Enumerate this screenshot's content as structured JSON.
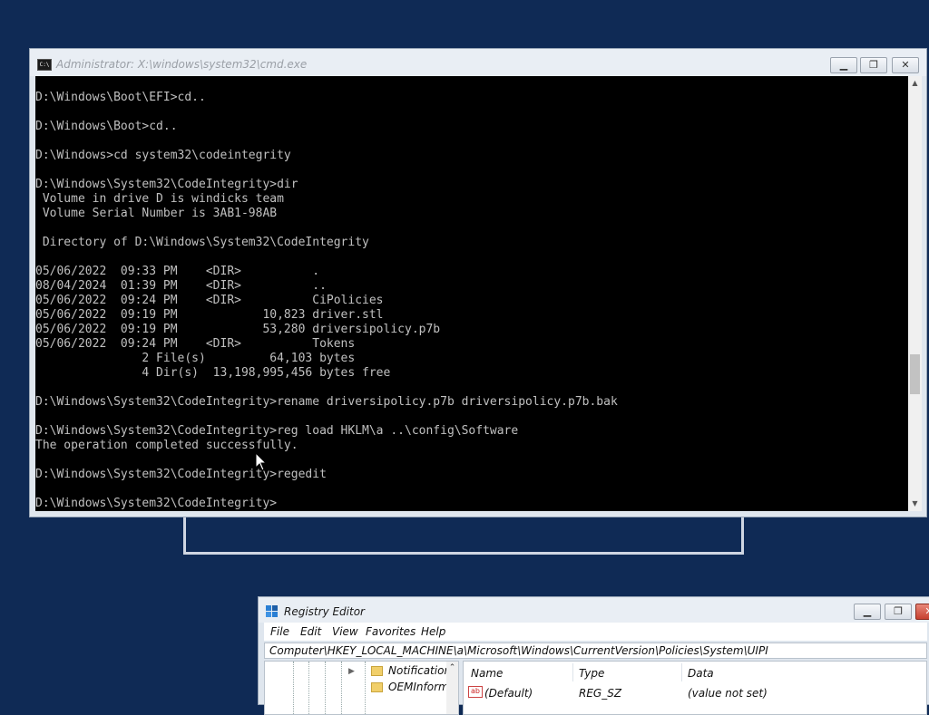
{
  "cmd_window": {
    "title": "Administrator: X:\\windows\\system32\\cmd.exe",
    "icon": "cmd-icon",
    "buttons": {
      "minimize": "minimize-icon",
      "maximize": "maximize-icon",
      "close": "close-icon"
    },
    "lines": [
      "D:\\Windows\\Boot\\EFI>cd..",
      "",
      "D:\\Windows\\Boot>cd..",
      "",
      "D:\\Windows>cd system32\\codeintegrity",
      "",
      "D:\\Windows\\System32\\CodeIntegrity>dir",
      " Volume in drive D is windicks team",
      " Volume Serial Number is 3AB1-98AB",
      "",
      " Directory of D:\\Windows\\System32\\CodeIntegrity",
      "",
      "05/06/2022  09:33 PM    <DIR>          .",
      "08/04/2024  01:39 PM    <DIR>          ..",
      "05/06/2022  09:24 PM    <DIR>          CiPolicies",
      "05/06/2022  09:19 PM            10,823 driver.stl",
      "05/06/2022  09:19 PM            53,280 driversipolicy.p7b",
      "05/06/2022  09:24 PM    <DIR>          Tokens",
      "               2 File(s)         64,103 bytes",
      "               4 Dir(s)  13,198,995,456 bytes free",
      "",
      "D:\\Windows\\System32\\CodeIntegrity>rename driversipolicy.p7b driversipolicy.p7b.bak",
      "",
      "D:\\Windows\\System32\\CodeIntegrity>reg load HKLM\\a ..\\config\\Software",
      "The operation completed successfully.",
      "",
      "D:\\Windows\\System32\\CodeIntegrity>regedit",
      "",
      "D:\\Windows\\System32\\CodeIntegrity>"
    ],
    "scroll_position": 0.72
  },
  "registry_editor": {
    "title": "Registry Editor",
    "menu": [
      "File",
      "Edit",
      "View",
      "Favorites",
      "Help"
    ],
    "address": "Computer\\HKEY_LOCAL_MACHINE\\a\\Microsoft\\Windows\\CurrentVersion\\Policies\\System\\UIPI",
    "tree_items": [
      "Notificatior",
      "OEMInform"
    ],
    "columns": [
      "Name",
      "Type",
      "Data"
    ],
    "rows": [
      {
        "name": "(Default)",
        "type": "REG_SZ",
        "data": "(value not set)"
      }
    ]
  },
  "colors": {
    "desktop": "#0f2a55",
    "console_bg": "#000000",
    "console_fg": "#c0c0c0"
  }
}
